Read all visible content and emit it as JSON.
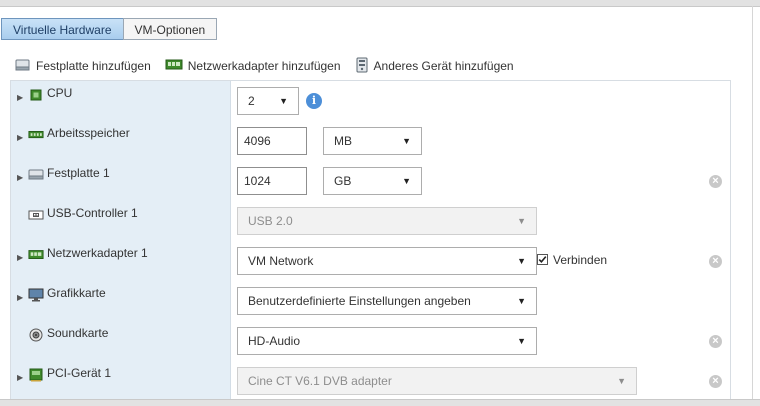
{
  "tabs": [
    {
      "label": "Virtuelle Hardware",
      "active": true
    },
    {
      "label": "VM-Optionen",
      "active": false
    }
  ],
  "toolbar": {
    "add_disk": {
      "label": "Festplatte hinzufügen",
      "icon": "hard-disk-icon"
    },
    "add_nic": {
      "label": "Netzwerkadapter hinzufügen",
      "icon": "network-adapter-icon"
    },
    "add_other": {
      "label": "Anderes Gerät hinzufügen",
      "icon": "generic-device-icon"
    }
  },
  "devices": [
    {
      "label": "CPU",
      "icon": "cpu-icon",
      "expandable": true,
      "select": {
        "value": "2"
      },
      "info": "i"
    },
    {
      "label": "Arbeitsspeicher",
      "icon": "memory-icon",
      "expandable": true,
      "input": {
        "value": "4096"
      },
      "unit": {
        "value": "MB"
      }
    },
    {
      "label": "Festplatte 1",
      "icon": "hard-disk-icon",
      "expandable": true,
      "input": {
        "value": "1024"
      },
      "unit": {
        "value": "GB"
      },
      "removable": true
    },
    {
      "label": "USB-Controller 1",
      "icon": "usb-icon",
      "expandable": false,
      "select": {
        "value": "USB 2.0",
        "disabled": true
      }
    },
    {
      "label": "Netzwerkadapter 1",
      "icon": "network-adapter-icon",
      "expandable": true,
      "select": {
        "value": "VM Network"
      },
      "checkbox": {
        "label": "Verbinden",
        "checked": true
      },
      "removable": true
    },
    {
      "label": "Grafikkarte",
      "icon": "monitor-icon",
      "expandable": true,
      "select": {
        "value": "Benutzerdefinierte Einstellungen angeben"
      }
    },
    {
      "label": "Soundkarte",
      "icon": "speaker-icon",
      "expandable": false,
      "select": {
        "value": "HD-Audio"
      },
      "removable": true
    },
    {
      "label": "PCI-Gerät 1",
      "icon": "pci-device-icon",
      "expandable": true,
      "select": {
        "value": "Cine CT V6.1 DVB adapter",
        "disabled": true
      },
      "removable": true
    }
  ],
  "colors": {
    "accent": "#4d8fd8",
    "active_tab": "#a9cdee",
    "label_column": "#e4eef6"
  }
}
